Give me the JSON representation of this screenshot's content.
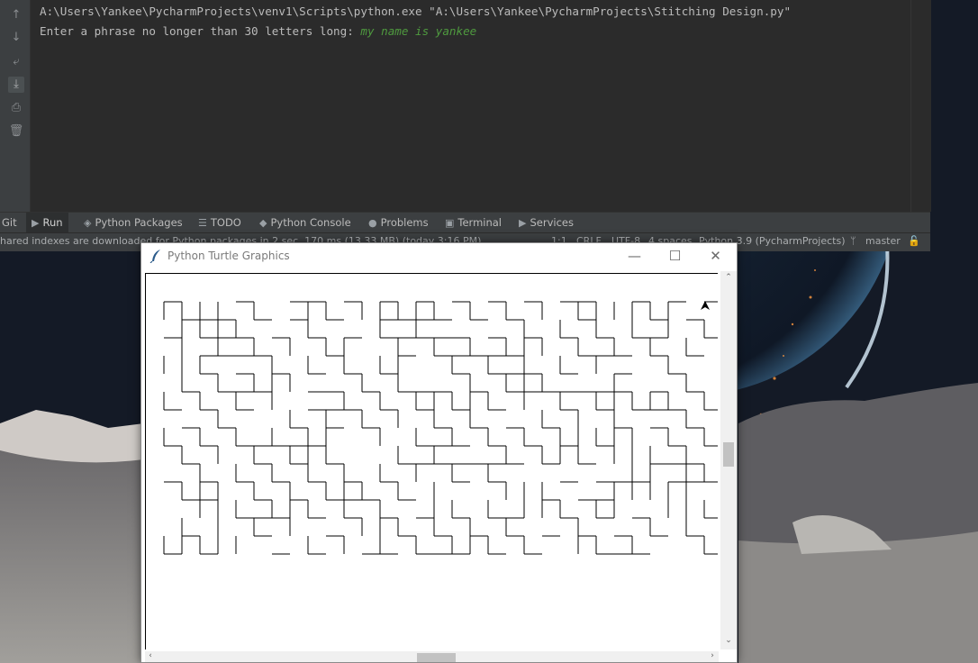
{
  "ide": {
    "left_toolbar": {
      "icons": [
        "arrow-up-icon",
        "arrow-down-icon",
        "soft-wrap-icon",
        "scroll-to-end-icon",
        "print-icon",
        "trash-icon"
      ]
    },
    "console": {
      "command_line": "A:\\Users\\Yankee\\PycharmProjects\\venv1\\Scripts\\python.exe \"A:\\Users\\Yankee\\PycharmProjects\\Stitching Design.py\"",
      "prompt": "Enter a phrase no longer than 30 letters long: ",
      "user_input": "my name is yankee"
    },
    "tool_tabs": [
      {
        "label": "Git",
        "icon": ""
      },
      {
        "label": "Run",
        "icon": "run-icon"
      },
      {
        "label": "Python Packages",
        "icon": "packages-icon"
      },
      {
        "label": "TODO",
        "icon": "todo-icon"
      },
      {
        "label": "Python Console",
        "icon": "python-console-icon"
      },
      {
        "label": "Problems",
        "icon": "problems-icon"
      },
      {
        "label": "Terminal",
        "icon": "terminal-icon"
      },
      {
        "label": "Services",
        "icon": "services-icon"
      }
    ],
    "status": {
      "message": "hared indexes are downloaded for Python packages in 2 sec, 170 ms (13.33 MB) (today 3:16 PM)",
      "position": "1:1",
      "line_sep": "CRLF",
      "encoding": "UTF-8",
      "indent": "4 spaces",
      "interpreter": "Python 3.9 (PycharmProjects)",
      "branch": "master"
    }
  },
  "turtle_window": {
    "title": "Python Turtle Graphics",
    "minimize": "—",
    "maximize": "☐",
    "close": "✕"
  },
  "colors": {
    "ide_bg": "#2b2b2b",
    "input_green": "#4f9a3f",
    "stitch_line": "#000000"
  }
}
